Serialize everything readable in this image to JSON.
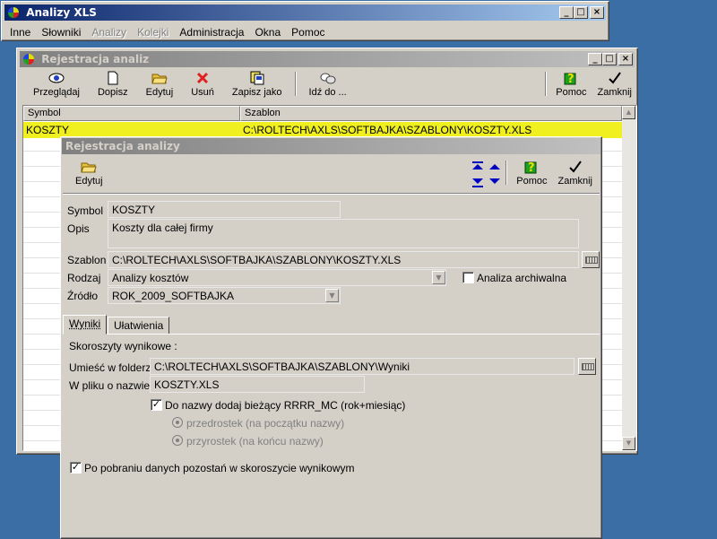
{
  "main_window": {
    "title": "Analizy XLS",
    "menu": [
      {
        "label": "Inne",
        "enabled": true
      },
      {
        "label": "Słowniki",
        "enabled": true
      },
      {
        "label": "Analizy",
        "enabled": false
      },
      {
        "label": "Kolejki",
        "enabled": false
      },
      {
        "label": "Administracja",
        "enabled": true
      },
      {
        "label": "Okna",
        "enabled": true
      },
      {
        "label": "Pomoc",
        "enabled": true
      }
    ]
  },
  "reg_window": {
    "title": "Rejestracja  analiz",
    "toolbar": {
      "przegladaj": "Przeglądaj",
      "dopisz": "Dopisz",
      "edytuj": "Edytuj",
      "usun": "Usuń",
      "zapisz_jako": "Zapisz jako",
      "idz_do": "Idź do ...",
      "pomoc": "Pomoc",
      "zamknij": "Zamknij"
    },
    "grid": {
      "columns": [
        "Symbol",
        "Szablon"
      ],
      "rows": [
        {
          "symbol": "KOSZTY",
          "szablon": "C:\\ROLTECH\\AXLS\\SOFTBAJKA\\SZABLONY\\KOSZTY.XLS"
        }
      ],
      "highlight_color": "#f0f020"
    }
  },
  "dialog": {
    "title": "Rejestracja analizy",
    "toolbar": {
      "edytuj": "Edytuj",
      "pomoc": "Pomoc",
      "zamknij": "Zamknij"
    },
    "labels": {
      "symbol": "Symbol",
      "opis": "Opis",
      "szablon": "Szablon",
      "rodzaj": "Rodzaj",
      "zrodlo": "Źródło",
      "analiza_archiwalna": "Analiza archiwalna"
    },
    "values": {
      "symbol": "KOSZTY",
      "opis": "Koszty dla całej firmy",
      "szablon": "C:\\ROLTECH\\AXLS\\SOFTBAJKA\\SZABLONY\\KOSZTY.XLS",
      "rodzaj": "Analizy kosztów",
      "zrodlo": "ROK_2009_SOFTBAJKA"
    },
    "tabs": [
      "Wyniki",
      "Ułatwienia"
    ],
    "wyniki": {
      "heading": "Skoroszyty wynikowe :",
      "folder_label": "Umieść w folderze",
      "folder_value": "C:\\ROLTECH\\AXLS\\SOFTBAJKA\\SZABLONY\\Wyniki",
      "file_label": "W pliku o nazwie",
      "file_value": "KOSZTY.XLS",
      "add_date_label": "Do nazwy dodaj bieżący RRRR_MC (rok+miesiąc)",
      "radio_prefix": "przedrostek (na początku nazwy)",
      "radio_suffix": "przyrostek (na końcu nazwy)",
      "stay_label": "Po pobraniu danych pozostań w skoroszycie wynikowym"
    }
  }
}
